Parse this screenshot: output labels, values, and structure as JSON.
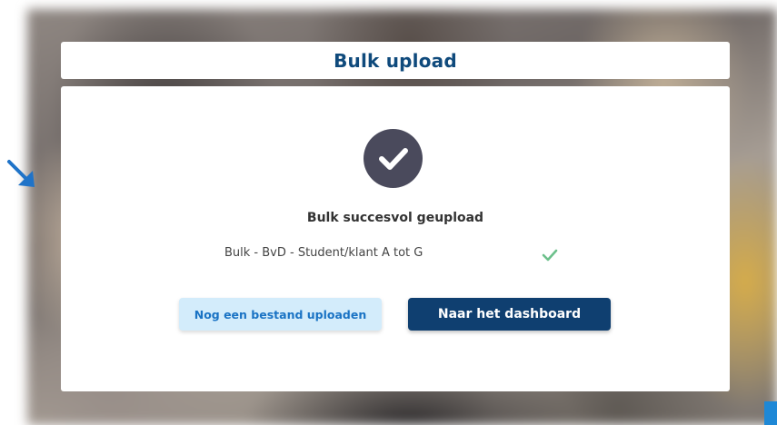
{
  "header": {
    "title": "Bulk upload"
  },
  "result": {
    "status_icon": "check-circle-icon",
    "status_title": "Bulk succesvol geupload",
    "file_name": "Bulk - BvD - Student/klant A tot G",
    "file_status_icon": "check-icon"
  },
  "actions": {
    "upload_another_label": "Nog een bestand uploaden",
    "dashboard_label": "Naar het dashboard"
  },
  "colors": {
    "brand_dark": "#0f3f70",
    "title_blue": "#0f4a7c",
    "secondary_bg": "#d3ecfb",
    "secondary_text": "#1a73c4",
    "success_green": "#6cc08b",
    "circle_gray": "#4a4a5c"
  }
}
